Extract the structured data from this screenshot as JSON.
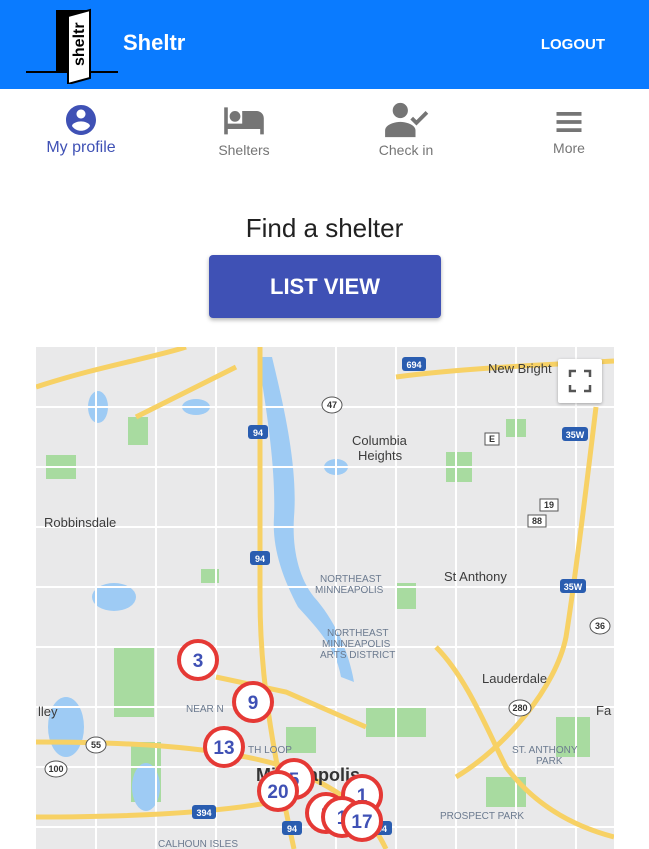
{
  "app": {
    "title": "Sheltr",
    "logo_text": "sheltr",
    "logout_label": "LOGOUT"
  },
  "nav": {
    "items": [
      {
        "label": "My profile",
        "icon": "account-circle-icon",
        "active": true
      },
      {
        "label": "Shelters",
        "icon": "bed-icon",
        "active": false
      },
      {
        "label": "Check in",
        "icon": "person-check-icon",
        "active": false
      },
      {
        "label": "More",
        "icon": "menu-icon",
        "active": false
      }
    ]
  },
  "main": {
    "heading": "Find a shelter",
    "list_view_label": "LIST VIEW"
  },
  "map": {
    "places": [
      "New Bright",
      "Columbia",
      "Heights",
      "Robbinsdale",
      "St Anthony",
      "NORTHEAST",
      "MINNEAPOLIS",
      "NORTHEAST",
      "MINNEAPOLIS",
      "ARTS DISTRICT",
      "Lauderdale",
      "NEAR N",
      "lley",
      "TH LOOP",
      "Minneapolis",
      "ST. ANTHONY",
      "PARK",
      "PROSPECT PARK",
      "Fa",
      "CALHOUN ISLES"
    ],
    "shields": [
      "694",
      "47",
      "94",
      "E",
      "35W",
      "19",
      "88",
      "94",
      "35W",
      "36",
      "280",
      "55",
      "100",
      "394",
      "94",
      "94"
    ],
    "markers": [
      "3",
      "9",
      "13",
      "20",
      "5",
      "1",
      "1",
      "1",
      "17"
    ],
    "colors": {
      "marker_ring": "#e53935",
      "marker_text": "#3f51b5",
      "water": "#9ecbf4",
      "park": "#a8dba0",
      "highway": "#f7d165"
    }
  },
  "colors": {
    "topbar": "#0a7bff",
    "accent": "#3f51b5"
  }
}
